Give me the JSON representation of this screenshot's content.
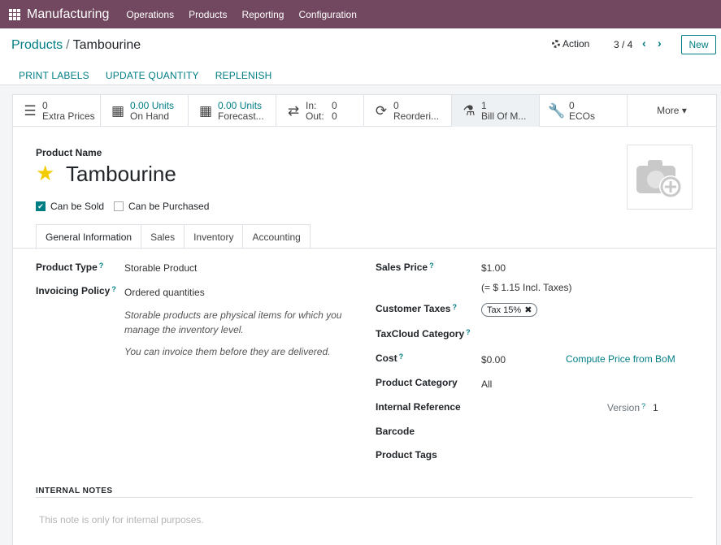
{
  "navbar": {
    "app_name": "Manufacturing",
    "menu": [
      "Operations",
      "Products",
      "Reporting",
      "Configuration"
    ]
  },
  "breadcrumb": {
    "parent": "Products",
    "separator": "/",
    "current": "Tambourine"
  },
  "actions": {
    "action_label": "Action",
    "pager": "3 / 4",
    "new_label": "New"
  },
  "statusbar": [
    "PRINT LABELS",
    "UPDATE QUANTITY",
    "REPLENISH"
  ],
  "smart_buttons": [
    {
      "value": "0",
      "label": "Extra Prices",
      "icon": "list-icon"
    },
    {
      "value": "0.00 Units",
      "label": "On Hand",
      "icon": "cubes-icon"
    },
    {
      "value": "0.00 Units",
      "label": "Forecast...",
      "icon": "cubes-icon"
    },
    {
      "in_label": "In:",
      "in_value": "0",
      "out_label": "Out:",
      "out_value": "0",
      "icon": "exchange-icon"
    },
    {
      "value": "0",
      "label": "Reorderi...",
      "icon": "refresh-icon"
    },
    {
      "value": "1",
      "label": "Bill Of M...",
      "icon": "flask-icon"
    },
    {
      "value": "0",
      "label": "ECOs",
      "icon": "wrench-icon"
    }
  ],
  "more_label": "More",
  "product": {
    "name_label": "Product Name",
    "name": "Tambourine",
    "can_be_sold": "Can be Sold",
    "can_be_purchased": "Can be Purchased"
  },
  "tabs": [
    "General Information",
    "Sales",
    "Inventory",
    "Accounting"
  ],
  "left_fields": {
    "product_type_label": "Product Type",
    "product_type": "Storable Product",
    "invoicing_policy_label": "Invoicing Policy",
    "invoicing_policy": "Ordered quantities",
    "note1": "Storable products are physical items for which you manage the inventory level.",
    "note2": "You can invoice them before they are delivered."
  },
  "right_fields": {
    "sales_price_label": "Sales Price",
    "sales_price": "$1.00",
    "incl_taxes": "(= $ 1.15 Incl. Taxes)",
    "customer_taxes_label": "Customer Taxes",
    "tax_tag": "Tax 15%",
    "taxcloud_label": "TaxCloud Category",
    "cost_label": "Cost",
    "cost": "$0.00",
    "compute_price": "Compute Price from BoM",
    "category_label": "Product Category",
    "category": "All",
    "internal_ref_label": "Internal Reference",
    "version_label": "Version",
    "version": "1",
    "barcode_label": "Barcode",
    "tags_label": "Product Tags"
  },
  "notes": {
    "title": "INTERNAL NOTES",
    "placeholder": "This note is only for internal purposes."
  },
  "colors": {
    "navbar": "#71485f",
    "accent": "#017e84",
    "star": "#f3cc00"
  }
}
